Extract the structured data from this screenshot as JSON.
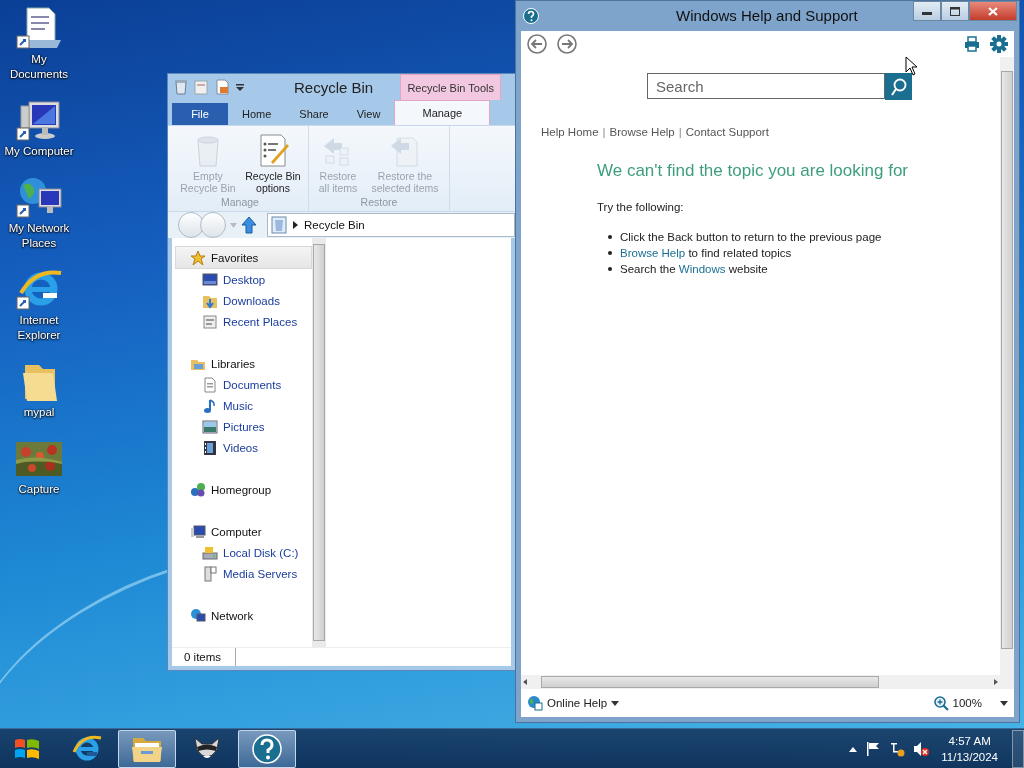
{
  "desktop": {
    "icons": [
      {
        "label": "My Documents"
      },
      {
        "label": "My Computer"
      },
      {
        "label": "My Network Places"
      },
      {
        "label": "Internet Explorer"
      },
      {
        "label": "mypal"
      },
      {
        "label": "Capture"
      }
    ]
  },
  "explorer": {
    "title": "Recycle Bin",
    "context_tab": "Recycle Bin Tools",
    "tabs": [
      {
        "label": "File",
        "kind": "file",
        "selected": false
      },
      {
        "label": "Home",
        "kind": "tab",
        "selected": false
      },
      {
        "label": "Share",
        "kind": "tab",
        "selected": false
      },
      {
        "label": "View",
        "kind": "tab",
        "selected": false
      },
      {
        "label": "Manage",
        "kind": "tab",
        "selected": true
      }
    ],
    "groups": [
      {
        "label": "Manage",
        "buttons": [
          {
            "label": "Empty Recycle Bin",
            "disabled": true
          },
          {
            "label": "Recycle Bin options",
            "disabled": false
          }
        ]
      },
      {
        "label": "Restore",
        "buttons": [
          {
            "label": "Restore all items",
            "disabled": true
          },
          {
            "label": "Restore the selected items",
            "disabled": true
          }
        ]
      }
    ],
    "address": "Recycle Bin",
    "nav": [
      {
        "label": "Favorites",
        "selected": true,
        "children": [
          {
            "label": "Desktop",
            "selected": false
          },
          {
            "label": "Downloads",
            "selected": false
          },
          {
            "label": "Recent Places",
            "selected": false
          }
        ]
      },
      {
        "label": "Libraries",
        "selected": false,
        "children": [
          {
            "label": "Documents",
            "selected": false
          },
          {
            "label": "Music",
            "selected": false
          },
          {
            "label": "Pictures",
            "selected": false
          },
          {
            "label": "Videos",
            "selected": false
          }
        ]
      },
      {
        "label": "Homegroup",
        "selected": false
      },
      {
        "label": "Computer",
        "selected": false,
        "children": [
          {
            "label": "Local Disk (C:)",
            "selected": false
          },
          {
            "label": "Media Servers",
            "selected": false
          }
        ]
      },
      {
        "label": "Network",
        "selected": false
      }
    ],
    "status": "0 items"
  },
  "help": {
    "title": "Windows Help and Support",
    "search": {
      "placeholder": "Search"
    },
    "breadcrumb": [
      {
        "kind": "link",
        "text": "Help Home"
      },
      {
        "kind": "separator",
        "text": "|"
      },
      {
        "kind": "link",
        "text": "Browse Help"
      },
      {
        "kind": "separator",
        "text": "|"
      },
      {
        "kind": "link",
        "text": "Contact Support"
      }
    ],
    "heading": "We can't find the topic you are looking for",
    "intro": "Try the following:",
    "suggestions": [
      {
        "parts": [
          {
            "text": "Click the Back button to return to the previous page",
            "link": false
          }
        ]
      },
      {
        "parts": [
          {
            "text": "Browse Help",
            "link": true
          },
          {
            "text": " to find related topics",
            "link": false
          }
        ]
      },
      {
        "parts": [
          {
            "text": "Search the ",
            "link": false
          },
          {
            "text": "Windows",
            "link": true
          },
          {
            "text": " website",
            "link": false
          }
        ]
      }
    ],
    "footer": {
      "help_source": "Online Help",
      "zoom": "100%"
    }
  },
  "taskbar": {
    "buttons": [
      {
        "kind": "ie",
        "selected": false
      },
      {
        "kind": "explorer",
        "selected": true
      },
      {
        "kind": "animal",
        "selected": false
      },
      {
        "kind": "help",
        "selected": true
      }
    ],
    "clock": {
      "time": "4:57 AM",
      "date": "11/13/2024"
    }
  }
}
